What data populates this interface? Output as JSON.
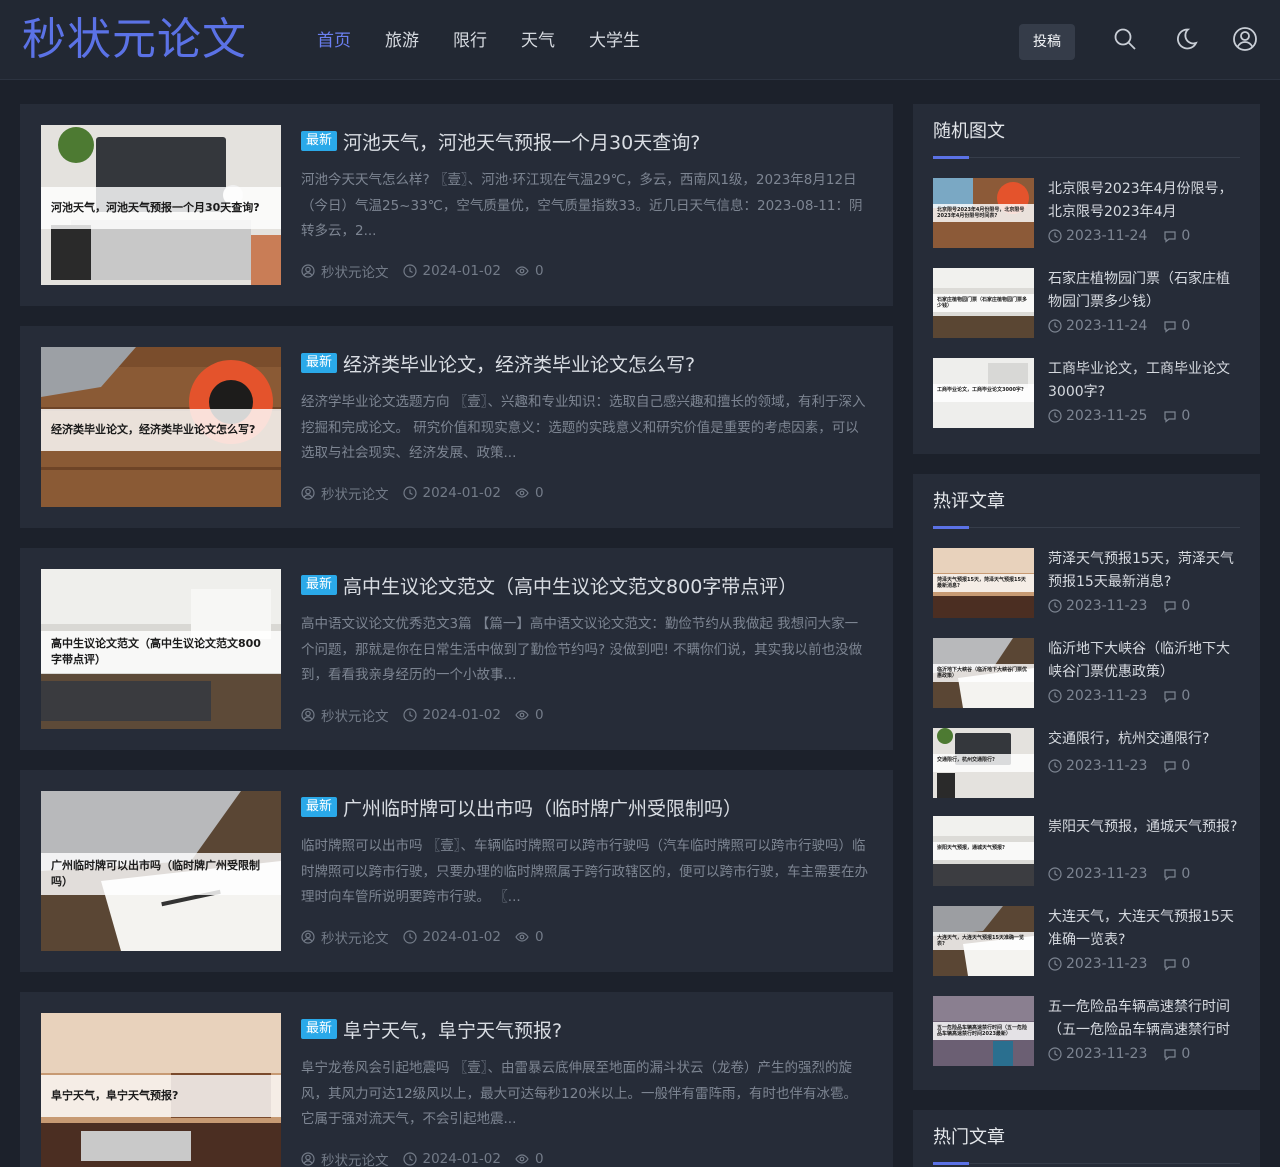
{
  "site": {
    "logo": "秒状元论文"
  },
  "nav": {
    "items": [
      {
        "label": "首页",
        "active": true
      },
      {
        "label": "旅游",
        "active": false
      },
      {
        "label": "限行",
        "active": false
      },
      {
        "label": "天气",
        "active": false
      },
      {
        "label": "大学生",
        "active": false
      }
    ],
    "submit_label": "投稿",
    "icons": [
      "search-icon",
      "moon-icon",
      "user-icon"
    ]
  },
  "colors": {
    "accent": "#5b72e6",
    "badge": "#2aa9e9",
    "background": "#1c212b",
    "card": "#262c38"
  },
  "articles": [
    {
      "badge": "最新",
      "title": "河池天气，河池天气预报一个月30天查询?",
      "thumb_caption": "河池天气，河池天气预报一个月30天查询?",
      "excerpt": "河池今天天气怎么样? 〖壹〗、河池·环江现在气温29℃，多云，西南风1级，2023年8月12日（今日）气温25~33℃，空气质量优，空气质量指数33。近几日天气信息：2023-08-11：阴转多云，2...",
      "author": "秒状元论文",
      "date": "2024-01-02",
      "views": "0"
    },
    {
      "badge": "最新",
      "title": "经济类毕业论文，经济类毕业论文怎么写?",
      "thumb_caption": "经济类毕业论文，经济类毕业论文怎么写?",
      "excerpt": "经济学毕业论文选题方向 〖壹〗、兴趣和专业知识：选取自己感兴趣和擅长的领域，有利于深入挖掘和完成论文。 研究价值和现实意义：选题的实践意义和研究价值是重要的考虑因素，可以选取与社会现实、经济发展、政策...",
      "author": "秒状元论文",
      "date": "2024-01-02",
      "views": "0"
    },
    {
      "badge": "最新",
      "title": "高中生议论文范文（高中生议论文范文800字带点评）",
      "thumb_caption": "高中生议论文范文（高中生议论文范文800字带点评）",
      "excerpt": "高中语文议论文优秀范文3篇 【篇一】高中语文议论文范文：勤俭节约从我做起 我想问大家一个问题，那就是你在日常生活中做到了勤俭节约吗? 没做到吧! 不瞒你们说，其实我以前也没做到，看看我亲身经历的一个小故事...",
      "author": "秒状元论文",
      "date": "2024-01-02",
      "views": "0"
    },
    {
      "badge": "最新",
      "title": "广州临时牌可以出市吗（临时牌广州受限制吗）",
      "thumb_caption": "广州临时牌可以出市吗（临时牌广州受限制吗）",
      "excerpt": "临时牌照可以出市吗 〖壹〗、车辆临时牌照可以跨市行驶吗（汽车临时牌照可以跨市行驶吗）临时牌照可以跨市行驶，只要办理的临时牌照属于跨行政辖区的，便可以跨市行驶，车主需要在办理时向车管所说明要跨市行驶。 〖...",
      "author": "秒状元论文",
      "date": "2024-01-02",
      "views": "0"
    },
    {
      "badge": "最新",
      "title": "阜宁天气，阜宁天气预报?",
      "thumb_caption": "阜宁天气，阜宁天气预报?",
      "excerpt": "阜宁龙卷风会引起地震吗 〖壹〗、由雷暴云底伸展至地面的漏斗状云（龙卷）产生的强烈的旋风，其风力可达12级风以上，最大可达每秒120米以上。一般伴有雷阵雨，有时也伴有冰雹。它属于强对流天气，不会引起地震...",
      "author": "秒状元论文",
      "date": "2024-01-02",
      "views": "0"
    }
  ],
  "sidebar": {
    "random": {
      "title": "随机图文",
      "items": [
        {
          "title": "北京限号2023年4月份限号，北京限号2023年4月",
          "thumb_caption": "北京限号2023年4月份限号，北京限号2023年4月份限号时间表?",
          "date": "2023-11-24",
          "comments": "0"
        },
        {
          "title": "石家庄植物园门票（石家庄植物园门票多少钱）",
          "thumb_caption": "石家庄植物园门票（石家庄植物园门票多少钱）",
          "date": "2023-11-24",
          "comments": "0"
        },
        {
          "title": "工商毕业论文，工商毕业论文3000字?",
          "thumb_caption": "工商毕业论文，工商毕业论文3000字?",
          "date": "2023-11-25",
          "comments": "0"
        }
      ]
    },
    "hot_comments": {
      "title": "热评文章",
      "items": [
        {
          "title": "菏泽天气预报15天，菏泽天气预报15天最新消息?",
          "thumb_caption": "菏泽天气预报15天，菏泽天气预报15天最新消息?",
          "date": "2023-11-23",
          "comments": "0"
        },
        {
          "title": "临沂地下大峡谷（临沂地下大峡谷门票优惠政策）",
          "thumb_caption": "临沂地下大峡谷（临沂地下大峡谷门票优惠政策）",
          "date": "2023-11-23",
          "comments": "0"
        },
        {
          "title": "交通限行，杭州交通限行?",
          "thumb_caption": "交通限行，杭州交通限行?",
          "date": "2023-11-23",
          "comments": "0"
        },
        {
          "title": "崇阳天气预报，通城天气预报?",
          "thumb_caption": "崇阳天气预报，通城天气预报?",
          "date": "2023-11-23",
          "comments": "0"
        },
        {
          "title": "大连天气，大连天气预报15天准确一览表?",
          "thumb_caption": "大连天气，大连天气预报15天准确一览表?",
          "date": "2023-11-23",
          "comments": "0"
        },
        {
          "title": "五一危险品车辆高速禁行时间（五一危险品车辆高速禁行时",
          "thumb_caption": "五一危险品车辆高速禁行时间（五一危险品车辆高速禁行时间2023最新）",
          "date": "2023-11-23",
          "comments": "0"
        }
      ]
    },
    "hot": {
      "title": "热门文章"
    }
  }
}
